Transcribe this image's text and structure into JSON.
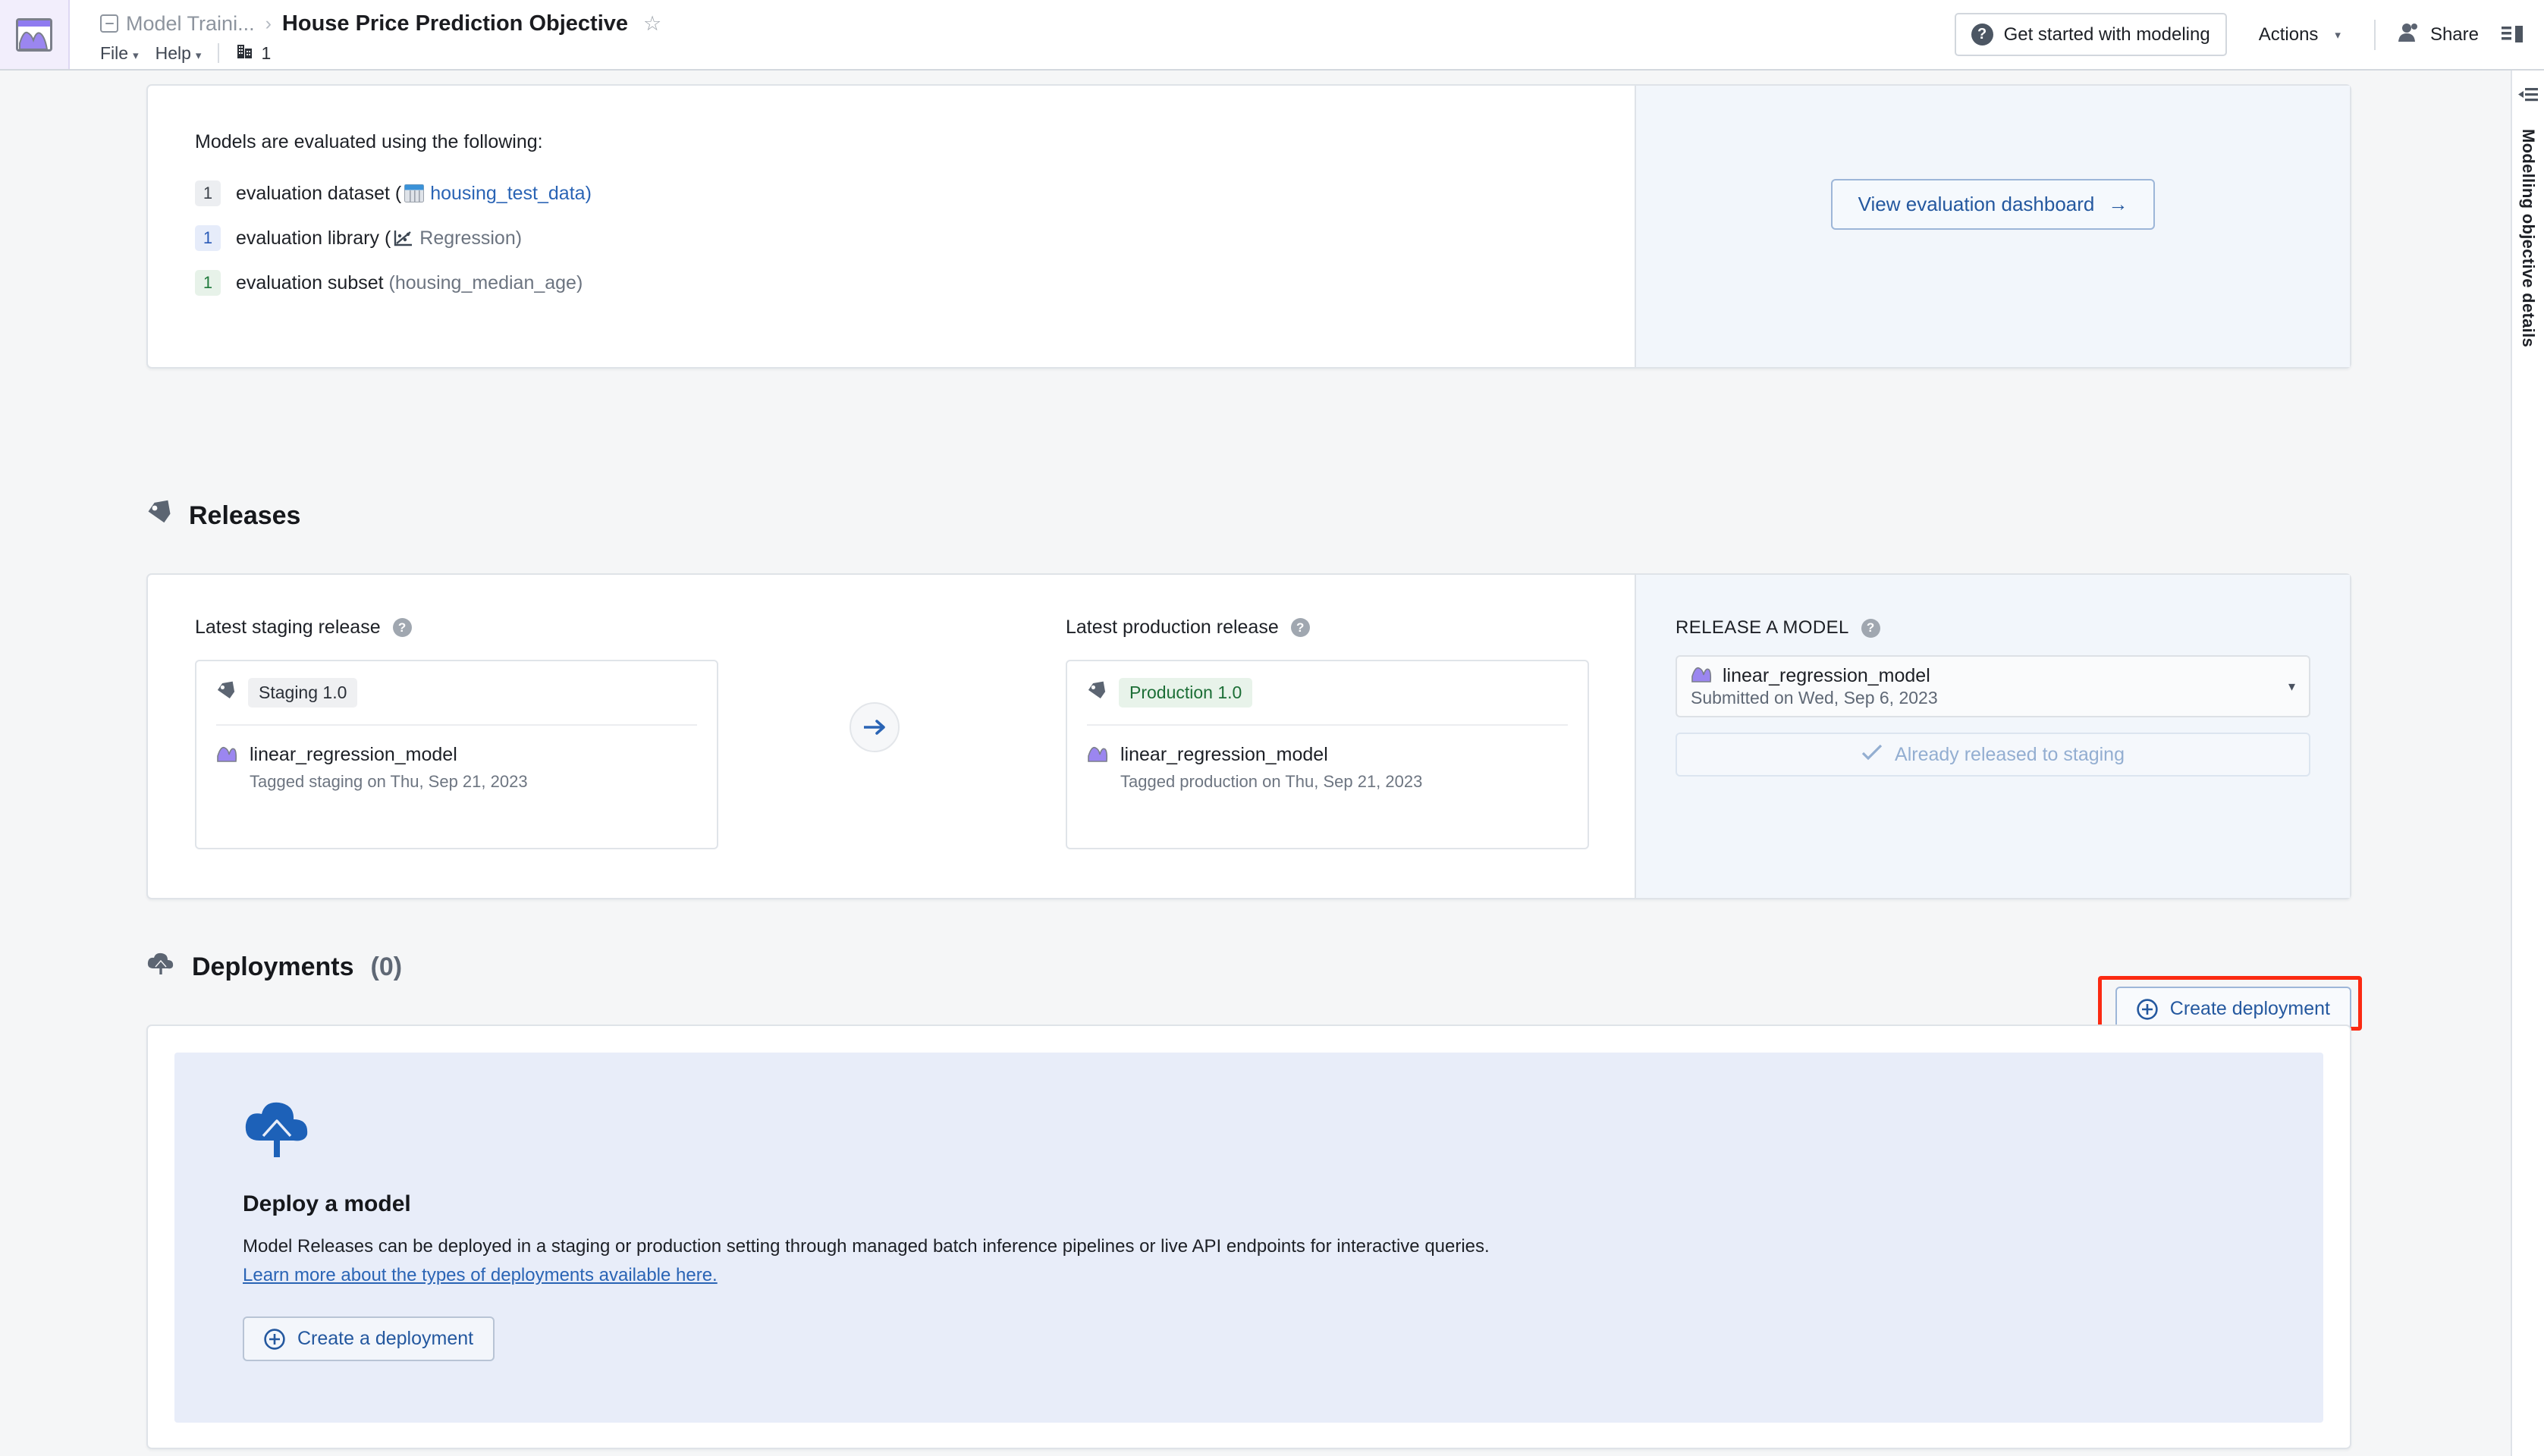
{
  "header": {
    "app_icon": "chart-app-icon",
    "breadcrumb_icon": "notebook-icon",
    "breadcrumb_parent": "Model Traini...",
    "breadcrumb_separator": "›",
    "page_title": "House Price Prediction Objective",
    "favorite_icon": "star-outline-icon",
    "menus": [
      {
        "label": "File",
        "caret": "▾"
      },
      {
        "label": "Help",
        "caret": "▾"
      }
    ],
    "branch_icon": "branch-icon",
    "branch_count": "1",
    "get_started_label": "Get started with modeling",
    "get_started_icon": "question-circle-icon",
    "actions_label": "Actions",
    "actions_caret": "▾",
    "share_label": "Share",
    "share_icon": "person-icon",
    "panel_toggle_icon": "layout-panel-icon"
  },
  "right_rail": {
    "collapse_icon": "collapse-panel-icon",
    "vertical_label": "Modelling objective details"
  },
  "evaluation": {
    "heading": "Models are evaluated using the following:",
    "rows": [
      {
        "count": "1",
        "count_color": "#eceef1",
        "label": "evaluation dataset",
        "open_paren": "(",
        "value_icon": "table-dataset-icon",
        "value": "housing_test_data",
        "close_paren": ")",
        "value_style": "link"
      },
      {
        "count": "1",
        "count_color": "#e6ecfa",
        "label": "evaluation library",
        "open_paren": "(",
        "value_icon": "scatter-regression-icon",
        "value": "Regression",
        "close_paren": ")",
        "value_style": "muted"
      },
      {
        "count": "1",
        "count_color": "#e7f2e9",
        "label": "evaluation subset",
        "open_paren": "(",
        "value_icon": "",
        "value": "housing_median_age",
        "close_paren": ")",
        "value_style": "muted"
      }
    ],
    "dashboard_button": "View evaluation dashboard",
    "dashboard_button_arrow": "→"
  },
  "releases": {
    "section_icon": "tag-icon",
    "section_title": "Releases",
    "staging": {
      "column_label": "Latest staging release",
      "help_icon": "question-circle-icon",
      "tag_icon": "tag-icon",
      "tag_label": "Staging 1.0",
      "model_icon": "model-icon",
      "model_name": "linear_regression_model",
      "model_sub": "Tagged staging on Thu, Sep 21, 2023"
    },
    "promote_arrow_icon": "arrow-right-icon",
    "production": {
      "column_label": "Latest production release",
      "help_icon": "question-circle-icon",
      "tag_icon": "tag-icon",
      "tag_label": "Production 1.0",
      "model_icon": "model-icon",
      "model_name": "linear_regression_model",
      "model_sub": "Tagged production on Thu, Sep 21, 2023"
    },
    "release_panel": {
      "label": "RELEASE A MODEL",
      "help_icon": "question-circle-icon",
      "selected_model_icon": "model-icon",
      "selected_model": "linear_regression_model",
      "selected_model_sub": "Submitted on Wed, Sep 6, 2023",
      "dropdown_caret": "▾",
      "action_icon": "check-icon",
      "action_label": "Already released to staging",
      "action_disabled": true
    }
  },
  "deployments": {
    "section_icon": "cloud-upload-icon",
    "section_title": "Deployments",
    "section_count": "(0)",
    "create_button_label": "Create deployment",
    "create_button_icon": "plus-circle-icon",
    "create_button_highlighted": true,
    "highlight_color": "#fb2a12",
    "empty_state": {
      "illustration_icon": "cloud-upload-large-icon",
      "title": "Deploy a model",
      "description": "Model Releases can be deployed in a staging or production setting through managed batch inference pipelines or live API endpoints for interactive queries.",
      "link_text": "Learn more about the types of deployments available here.",
      "button_label": "Create a deployment",
      "button_icon": "plus-circle-icon"
    }
  },
  "colors": {
    "accent_blue": "#2a64b5",
    "panel_blue": "#f2f6fb",
    "empty_state_blue": "#e8edf9",
    "highlight_red": "#fb2a12",
    "model_purple": "#9b86f0",
    "production_green": "#1c6e36"
  }
}
